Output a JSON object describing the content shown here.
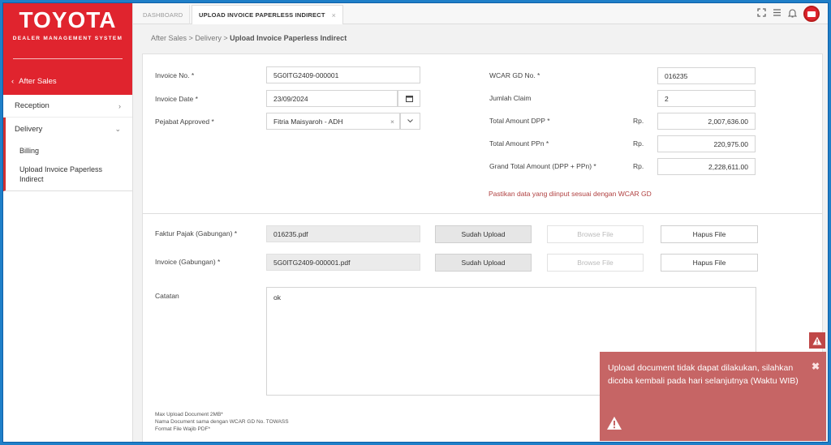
{
  "brand": {
    "logo": "TOYOTA",
    "subtitle": "DEALER MANAGEMENT SYSTEM",
    "back_label": "After Sales"
  },
  "sidebar": {
    "items": [
      {
        "label": "Reception"
      },
      {
        "label": "Delivery"
      }
    ],
    "sub_items": [
      {
        "label": "Billing"
      },
      {
        "label": "Upload Invoice Paperless Indirect"
      }
    ]
  },
  "tabs": [
    {
      "label": "DASHBOARD"
    },
    {
      "label": "UPLOAD INVOICE PAPERLESS INDIRECT",
      "close": "×"
    }
  ],
  "breadcrumb": {
    "part1": "After Sales",
    "sep": ">",
    "part2": "Delivery",
    "part3": "Upload Invoice Paperless Indirect"
  },
  "form": {
    "invoice_no_label": "Invoice No. *",
    "invoice_no": "5G0ITG2409-000001",
    "invoice_date_label": "Invoice Date *",
    "invoice_date": "23/09/2024",
    "pejabat_label": "Pejabat Approved *",
    "pejabat": "Fitria Maisyaroh - ADH",
    "wcar_label": "WCAR GD No. *",
    "wcar": "016235",
    "jumlah_label": "Jumlah Claim",
    "jumlah": "2",
    "dpp_label": "Total Amount DPP *",
    "dpp": "2,007,636.00",
    "ppn_label": "Total Amount PPn *",
    "ppn": "220,975.00",
    "grand_label": "Grand Total Amount (DPP + PPn) *",
    "grand": "2,228,611.00",
    "currency": "Rp.",
    "warning": "Pastikan data yang diinput sesuai dengan WCAR GD"
  },
  "uploads": [
    {
      "label": "Faktur Pajak (Gabungan) *",
      "file": "016235.pdf",
      "status": "Sudah Upload",
      "browse": "Browse File",
      "delete": "Hapus File"
    },
    {
      "label": "Invoice (Gabungan) *",
      "file": "5G0ITG2409-000001.pdf",
      "status": "Sudah Upload",
      "browse": "Browse File",
      "delete": "Hapus File"
    }
  ],
  "catatan": {
    "label": "Catatan",
    "value": "ok"
  },
  "notes": [
    "Max Upload Document 2MB*",
    "Nama Document sama dengan WCAR GD No. TOWASS",
    "Format File Wajib PDF*"
  ],
  "toast": {
    "message": "Upload document tidak dapat dilakukan, silahkan dicoba kembali pada hari selanjutnya (Waktu WIB)",
    "close": "✖"
  },
  "colors": {
    "brand_red": "#e0242e",
    "toast_bg": "#c66565",
    "warning_text": "#b04040"
  }
}
